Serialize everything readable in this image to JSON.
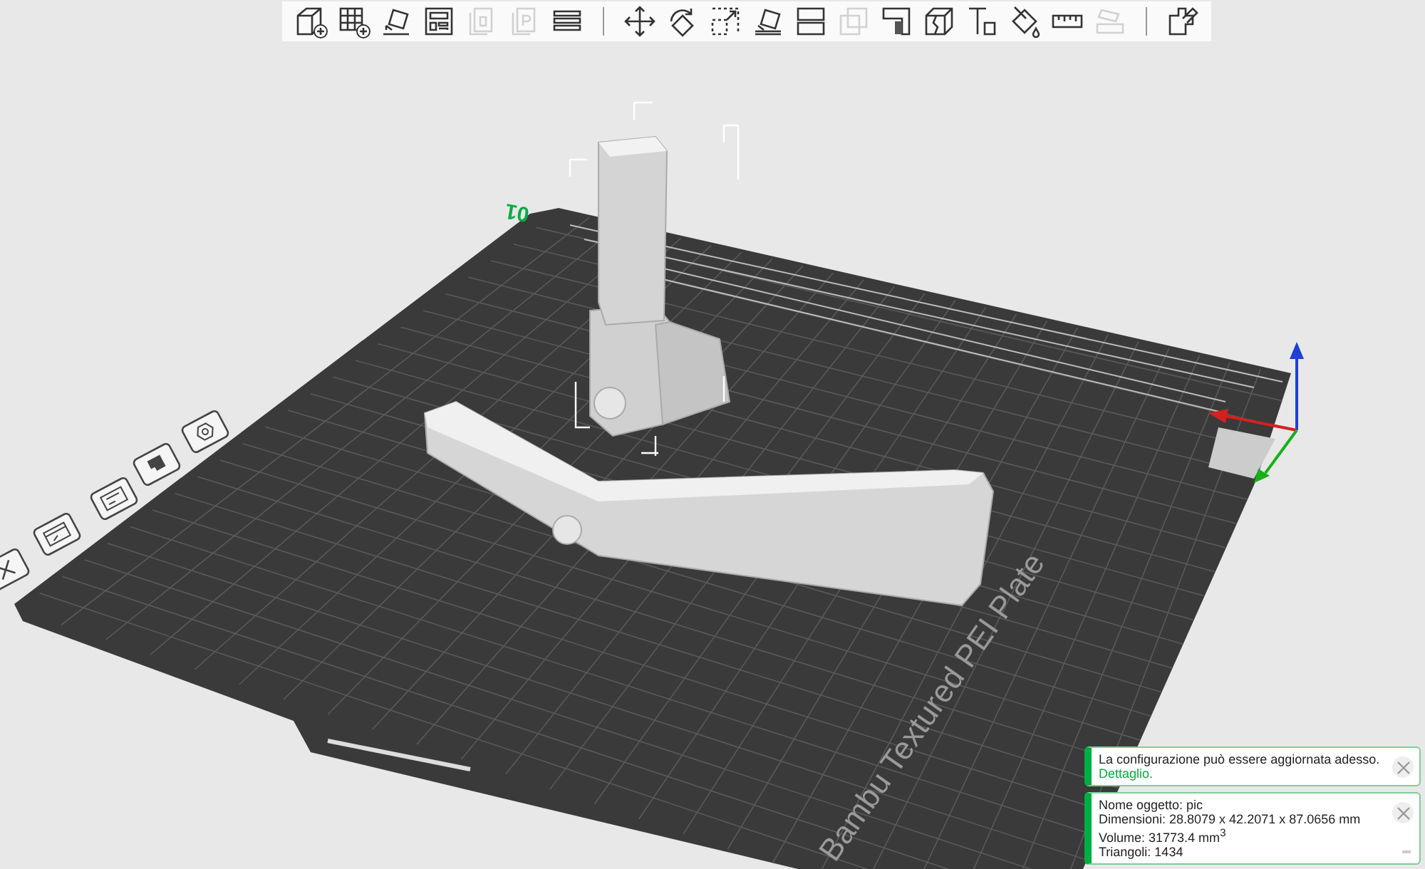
{
  "toolbar": {
    "tools": [
      {
        "kind": "tool",
        "disabled": false
      },
      {
        "kind": "tool",
        "disabled": false
      },
      {
        "kind": "tool",
        "disabled": false
      },
      {
        "kind": "tool",
        "disabled": false
      },
      {
        "kind": "tool",
        "disabled": true
      },
      {
        "kind": "tool",
        "disabled": true
      },
      {
        "kind": "tool",
        "disabled": false
      },
      {
        "kind": "separator"
      },
      {
        "kind": "tool",
        "disabled": false
      },
      {
        "kind": "tool",
        "disabled": false
      },
      {
        "kind": "tool",
        "disabled": false
      },
      {
        "kind": "tool",
        "disabled": false
      },
      {
        "kind": "tool",
        "disabled": false
      },
      {
        "kind": "tool",
        "disabled": true
      },
      {
        "kind": "tool",
        "disabled": false
      },
      {
        "kind": "tool",
        "disabled": false
      },
      {
        "kind": "tool",
        "disabled": false
      },
      {
        "kind": "tool",
        "disabled": false
      },
      {
        "kind": "tool",
        "disabled": false
      },
      {
        "kind": "tool",
        "disabled": true
      },
      {
        "kind": "separator"
      },
      {
        "kind": "tool",
        "disabled": false
      }
    ]
  },
  "plate": {
    "number": "01",
    "name": "Bambu Textured PEI Plate"
  },
  "notifications": [
    {
      "lines": [
        "La configurazione può essere aggiornata adesso."
      ],
      "link": "Dettaglio."
    },
    {
      "lines": [
        "Nome oggetto: pic",
        "Dimensioni: 28.8079 x 42.2071 x 87.0656 mm",
        "Volume: 31773.4 mm$^{3}$",
        "Triangoli: 1434"
      ]
    }
  ]
}
